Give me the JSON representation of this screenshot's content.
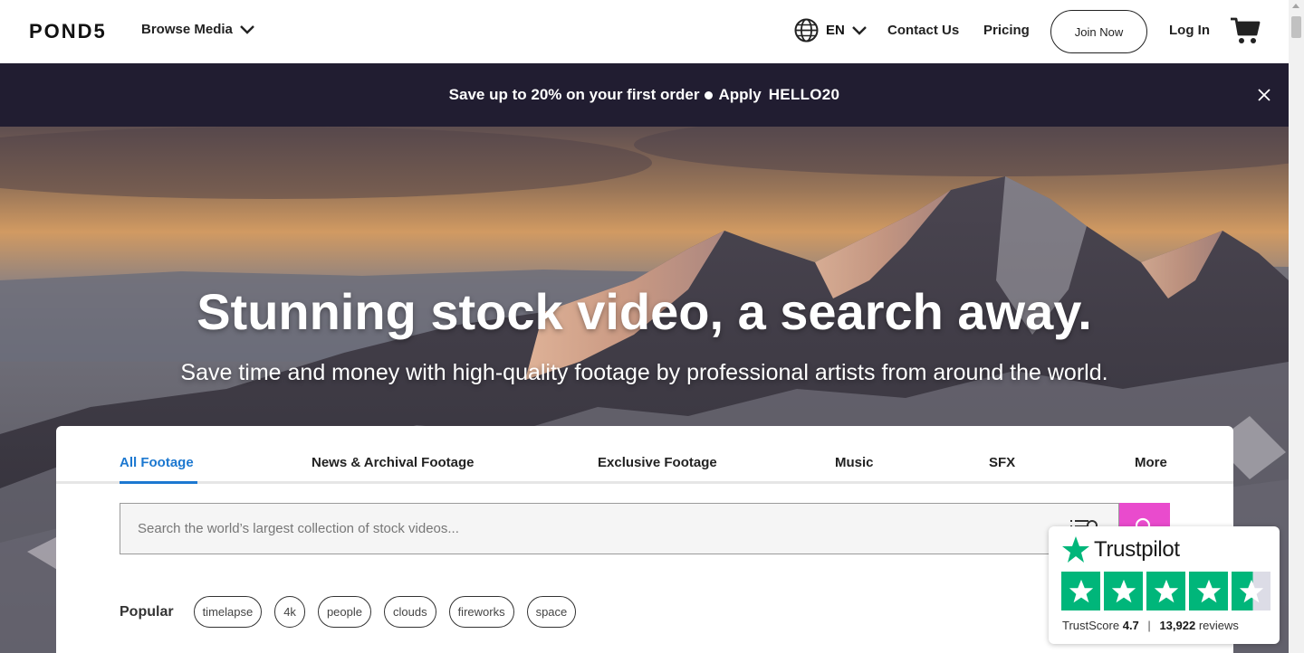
{
  "header": {
    "logo": "POND5",
    "browse_label": "Browse Media",
    "language": "EN",
    "contact_label": "Contact Us",
    "pricing_label": "Pricing",
    "join_label": "Join Now",
    "login_label": "Log In"
  },
  "promo": {
    "text": "Save up to 20% on your first order",
    "apply_label": "Apply",
    "code": "HELLO20"
  },
  "hero": {
    "title": "Stunning stock video, a search away.",
    "subtitle": "Save time and money with high-quality footage by professional artists from around the world."
  },
  "tabs": [
    {
      "label": "All Footage",
      "active": true
    },
    {
      "label": "News & Archival Footage",
      "active": false
    },
    {
      "label": "Exclusive Footage",
      "active": false
    },
    {
      "label": "Music",
      "active": false
    },
    {
      "label": "SFX",
      "active": false
    },
    {
      "label": "More",
      "active": false
    }
  ],
  "search": {
    "placeholder": "Search the world’s largest collection of stock videos...",
    "value": ""
  },
  "popular": {
    "label": "Popular",
    "tags": [
      "timelapse",
      "4k",
      "people",
      "clouds",
      "fireworks",
      "space"
    ]
  },
  "trustpilot": {
    "brand": "Trustpilot",
    "score_label": "TrustScore",
    "score": "4.7",
    "separator": "|",
    "reviews_count": "13,922",
    "reviews_label": "reviews",
    "rating": 4.7
  },
  "colors": {
    "promo_bg": "#211d31",
    "accent_blue": "#1c78d0",
    "search_button": "#e94bcd",
    "trustpilot_green": "#00b67a"
  }
}
